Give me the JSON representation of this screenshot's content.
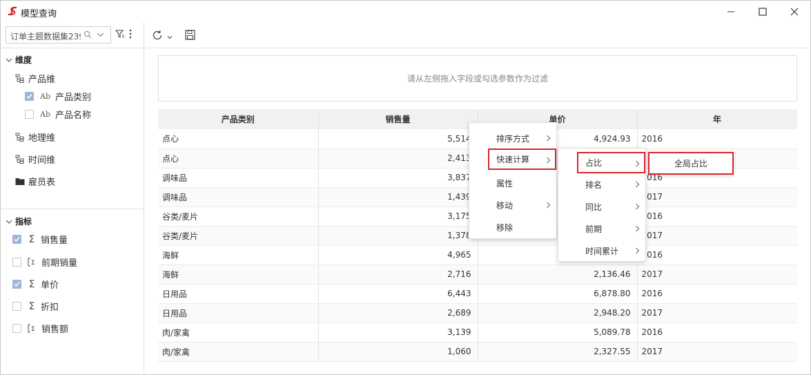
{
  "window": {
    "title": "模型查询",
    "logo_text": "S"
  },
  "left_panel": {
    "datasource": {
      "value": "订单主题数据集239",
      "placeholder": ""
    },
    "dimensions": {
      "header": "维度",
      "groups": [
        {
          "label": "产品维",
          "children": [
            {
              "label": "产品类别",
              "checked": true,
              "type_glyph": "Ab"
            },
            {
              "label": "产品名称",
              "checked": false,
              "type_glyph": "Ab"
            }
          ]
        },
        {
          "label": "地理维"
        },
        {
          "label": "时间维"
        },
        {
          "label": "雇员表"
        }
      ]
    },
    "measures": {
      "header": "指标",
      "items": [
        {
          "label": "销售量",
          "checked": true,
          "icon": "sigma-icon"
        },
        {
          "label": "前期销量",
          "checked": false,
          "icon": "calc-field-icon"
        },
        {
          "label": "单价",
          "checked": true,
          "icon": "sigma-icon"
        },
        {
          "label": "折扣",
          "checked": false,
          "icon": "sigma-icon"
        },
        {
          "label": "销售额",
          "checked": false,
          "icon": "calc-field-icon"
        }
      ]
    }
  },
  "filter_area": {
    "hint": "请从左侧拖入字段或勾选参数作为过滤"
  },
  "table": {
    "columns": [
      "产品类别",
      "销售量",
      "单价",
      "年"
    ],
    "rows": [
      [
        "点心",
        "5,514",
        "4,924.93",
        "2016"
      ],
      [
        "点心",
        "2,413",
        "",
        ""
      ],
      [
        "调味品",
        "3,837",
        "",
        "2016"
      ],
      [
        "调味品",
        "1,439",
        "",
        "2017"
      ],
      [
        "谷类/麦片",
        "3,175",
        "",
        "2016"
      ],
      [
        "谷类/麦片",
        "1,378",
        "",
        "2017"
      ],
      [
        "海鲜",
        "4,965",
        "",
        "2016"
      ],
      [
        "海鲜",
        "2,716",
        "2,136.46",
        "2017"
      ],
      [
        "日用品",
        "6,443",
        "6,878.80",
        "2016"
      ],
      [
        "日用品",
        "2,689",
        "2,948.20",
        "2017"
      ],
      [
        "肉/家禽",
        "3,139",
        "5,089.78",
        "2016"
      ],
      [
        "肉/家禽",
        "1,060",
        "2,327.55",
        "2017"
      ]
    ]
  },
  "context_menu": {
    "items": [
      "排序方式",
      "快速计算",
      "属性",
      "移动",
      "移除"
    ]
  },
  "quick_calc_menu": {
    "items": [
      "占比",
      "排名",
      "同比",
      "前期",
      "时间累计"
    ]
  },
  "ratio_menu": {
    "items": [
      "全局占比"
    ]
  },
  "colors": {
    "brand_red": "#d9252a",
    "checkbox_checked": "#9fb4d8",
    "header_bg": "#f0f1f3"
  }
}
